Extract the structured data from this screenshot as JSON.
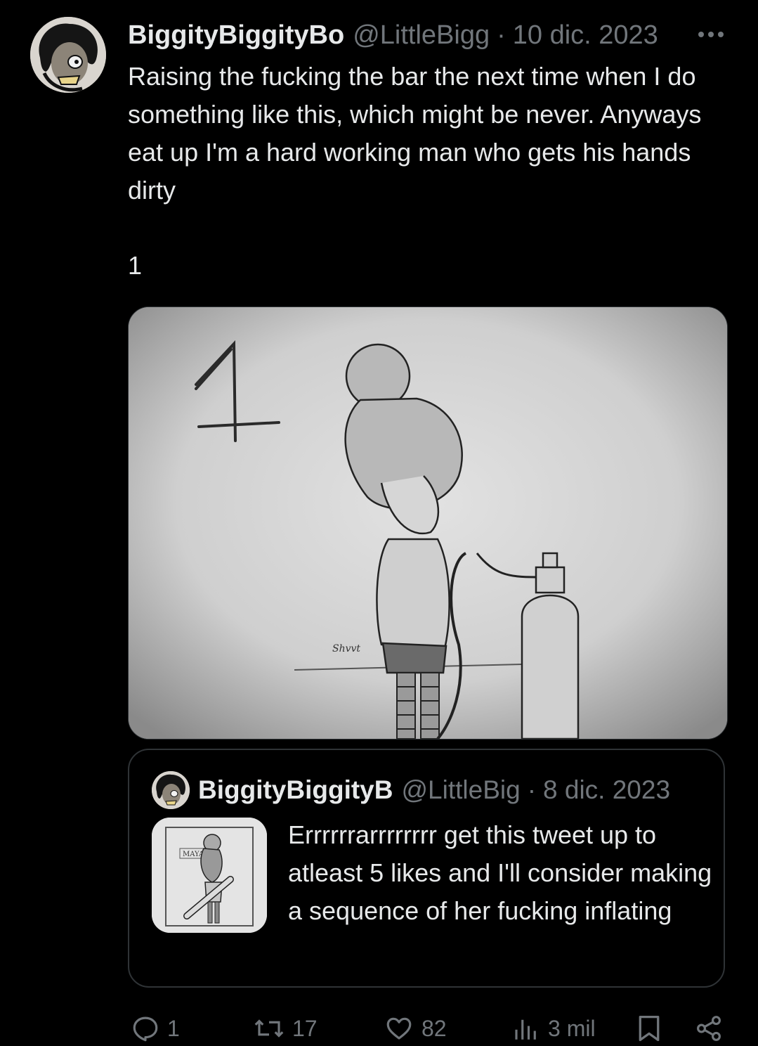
{
  "tweet": {
    "display_name": "BiggityBiggityBo",
    "handle": "@LittleBigg",
    "separator": "·",
    "date": "10 dic. 2023",
    "text": "Raising the fucking the bar the next time when I do something like this, which might be never. Anyways eat up I'm a hard working man who gets his hands dirty",
    "number_line": "1"
  },
  "media": {
    "drawing_number": "1",
    "signature": "Shvvt"
  },
  "quote": {
    "display_name": "BiggityBiggityB",
    "handle": "@LittleBig",
    "separator": "·",
    "date": "8 dic. 2023",
    "text": "Errrrrrarrrrrrrr get this tweet up to atleast 5 likes and I'll consider making a sequence of her fucking inflating",
    "thumb_label": "MAYA"
  },
  "actions": {
    "replies": "1",
    "reposts": "17",
    "likes": "82",
    "views": "3 mil"
  },
  "colors": {
    "background": "#000000",
    "text": "#e7e9ea",
    "muted": "#71767b",
    "border": "#2f3336"
  },
  "icons": [
    "more-icon",
    "reply-icon",
    "repost-icon",
    "like-icon",
    "views-icon",
    "bookmark-icon",
    "share-icon"
  ]
}
